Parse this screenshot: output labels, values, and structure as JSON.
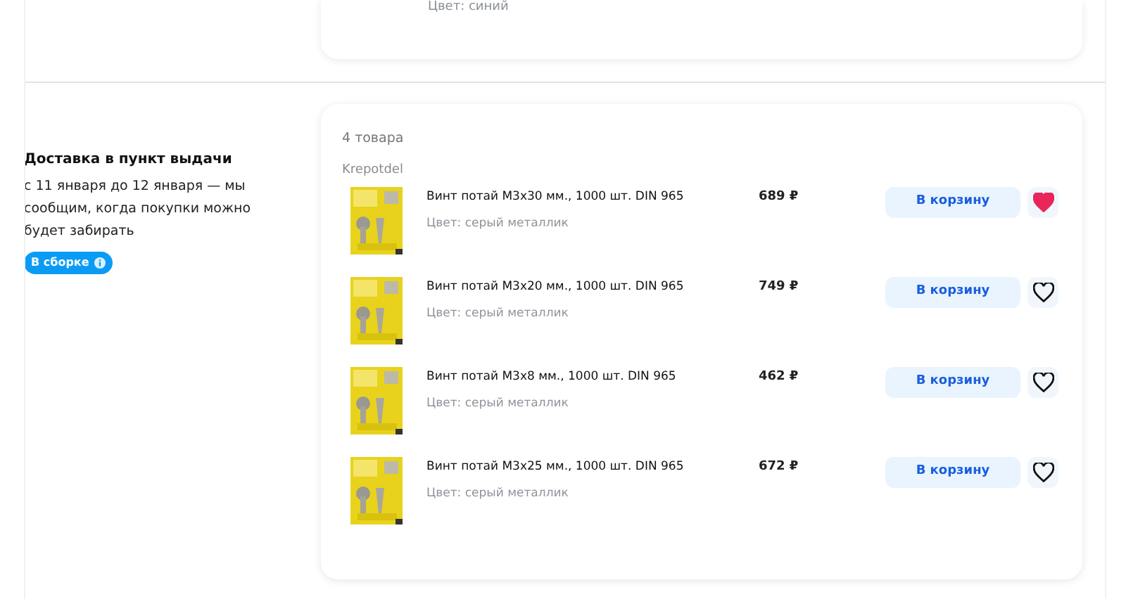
{
  "previous_order": {
    "color_line": "Цвет: синий"
  },
  "delivery": {
    "title": "Доставка в пункт выдачи",
    "description": "с 11 января до 12 января — мы сообщим, когда покупки можно будет забирать",
    "status": "В сборке"
  },
  "order": {
    "count": "4 товара",
    "seller": "Krepotdel",
    "items": [
      {
        "name": "Винт потай М3х30 мм., 1000 шт. DIN 965",
        "color_line": "Цвет: серый металлик",
        "price": "689 ₽",
        "cart_button": "В корзину",
        "favorite": true
      },
      {
        "name": "Винт потай М3х20 мм., 1000 шт. DIN 965",
        "color_line": "Цвет: серый металлик",
        "price": "749 ₽",
        "cart_button": "В корзину",
        "favorite": false
      },
      {
        "name": "Винт потай М3х8 мм., 1000 шт. DIN 965",
        "color_line": "Цвет: серый металлик",
        "price": "462 ₽",
        "cart_button": "В корзину",
        "favorite": false
      },
      {
        "name": "Винт потай М3х25 мм., 1000 шт. DIN 965",
        "color_line": "Цвет: серый металлик",
        "price": "672 ₽",
        "cart_button": "В корзину",
        "favorite": false
      }
    ]
  }
}
